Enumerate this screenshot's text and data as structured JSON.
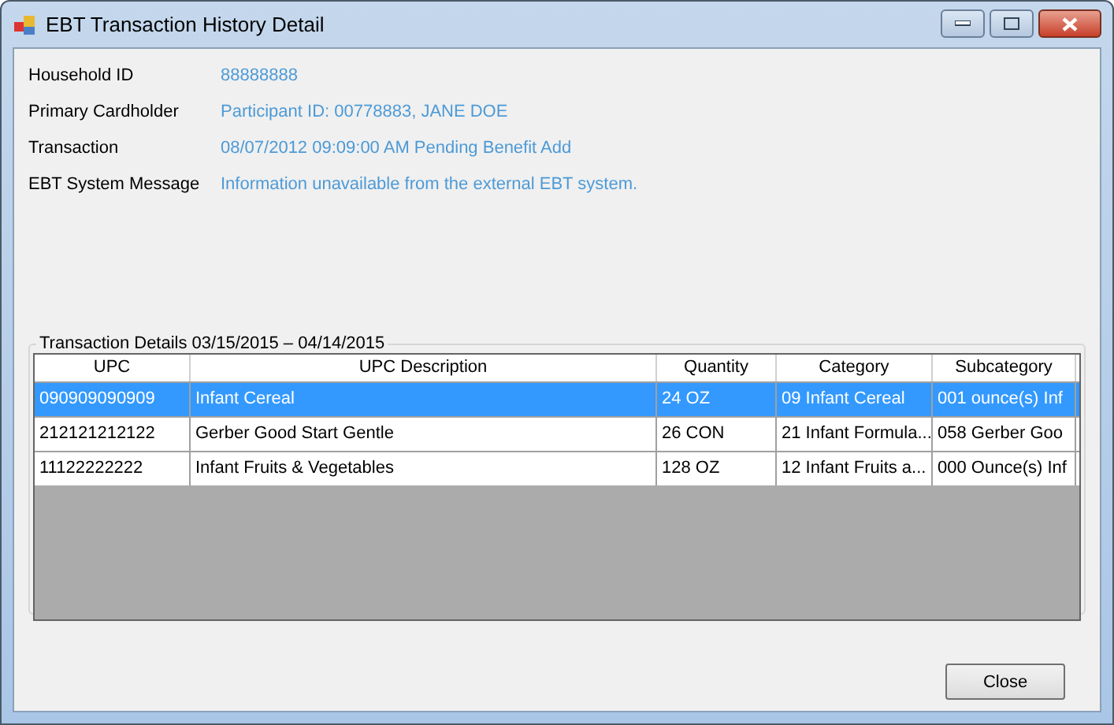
{
  "window": {
    "title": "EBT Transaction History Detail"
  },
  "fields": [
    {
      "label": "Household ID",
      "value": "88888888"
    },
    {
      "label": "Primary Cardholder",
      "value": "Participant ID: 00778883, JANE DOE"
    },
    {
      "label": "Transaction",
      "value": "08/07/2012 09:09:00 AM Pending Benefit Add"
    },
    {
      "label": "EBT System Message",
      "value": "Information unavailable from the external EBT system."
    }
  ],
  "group": {
    "title": "Transaction Details 03/15/2015 – 04/14/2015"
  },
  "table": {
    "columns": [
      "UPC",
      "UPC Description",
      "Quantity",
      "Category",
      "Subcategory"
    ],
    "rows": [
      {
        "selected": true,
        "cells": [
          "090909090909",
          "Infant Cereal",
          "24 OZ",
          "09 Infant Cereal",
          "001 ounce(s) Inf"
        ]
      },
      {
        "selected": false,
        "cells": [
          "212121212122",
          "Gerber Good Start Gentle",
          "26 CON",
          "21 Infant Formula...",
          "058 Gerber Goo"
        ]
      },
      {
        "selected": false,
        "cells": [
          "11122222222",
          "Infant Fruits & Vegetables",
          "128 OZ",
          "12 Infant Fruits a...",
          "000 Ounce(s) Inf"
        ]
      }
    ]
  },
  "buttons": [
    "Close"
  ]
}
